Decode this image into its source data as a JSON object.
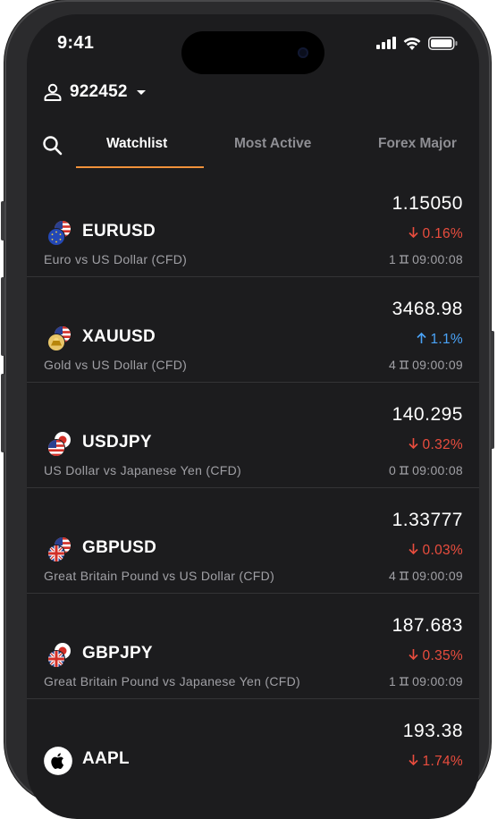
{
  "status_bar": {
    "time": "9:41"
  },
  "account": {
    "number": "922452"
  },
  "tabs": [
    {
      "label": "Watchlist",
      "active": true
    },
    {
      "label": "Most Active",
      "active": false
    },
    {
      "label": "Forex Major",
      "active": false
    }
  ],
  "colors": {
    "accent": "#f0913a",
    "down": "#ea4d3e",
    "up": "#4aa3f7",
    "background": "#1c1c1e"
  },
  "watchlist": [
    {
      "symbol": "EURUSD",
      "description": "Euro vs US Dollar (CFD)",
      "price": "1.15050",
      "change": "0.16%",
      "direction": "down",
      "count": "1",
      "time": "09:00:08",
      "icon": "eu-us-flags-icon"
    },
    {
      "symbol": "XAUUSD",
      "description": "Gold vs US Dollar (CFD)",
      "price": "3468.98",
      "change": "1.1%",
      "direction": "up",
      "count": "4",
      "time": "09:00:09",
      "icon": "gold-us-flags-icon"
    },
    {
      "symbol": "USDJPY",
      "description": "US Dollar vs Japanese Yen (CFD)",
      "price": "140.295",
      "change": "0.32%",
      "direction": "down",
      "count": "0",
      "time": "09:00:08",
      "icon": "us-jp-flags-icon"
    },
    {
      "symbol": "GBPUSD",
      "description": "Great Britain Pound vs US Dollar (CFD)",
      "price": "1.33777",
      "change": "0.03%",
      "direction": "down",
      "count": "4",
      "time": "09:00:09",
      "icon": "gb-us-flags-icon"
    },
    {
      "symbol": "GBPJPY",
      "description": "Great Britain Pound vs Japanese Yen (CFD)",
      "price": "187.683",
      "change": "0.35%",
      "direction": "down",
      "count": "1",
      "time": "09:00:09",
      "icon": "gb-jp-flags-icon"
    },
    {
      "symbol": "AAPL",
      "description": "",
      "price": "193.38",
      "change": "1.74%",
      "direction": "down",
      "count": "",
      "time": "",
      "icon": "apple-logo-icon"
    }
  ]
}
